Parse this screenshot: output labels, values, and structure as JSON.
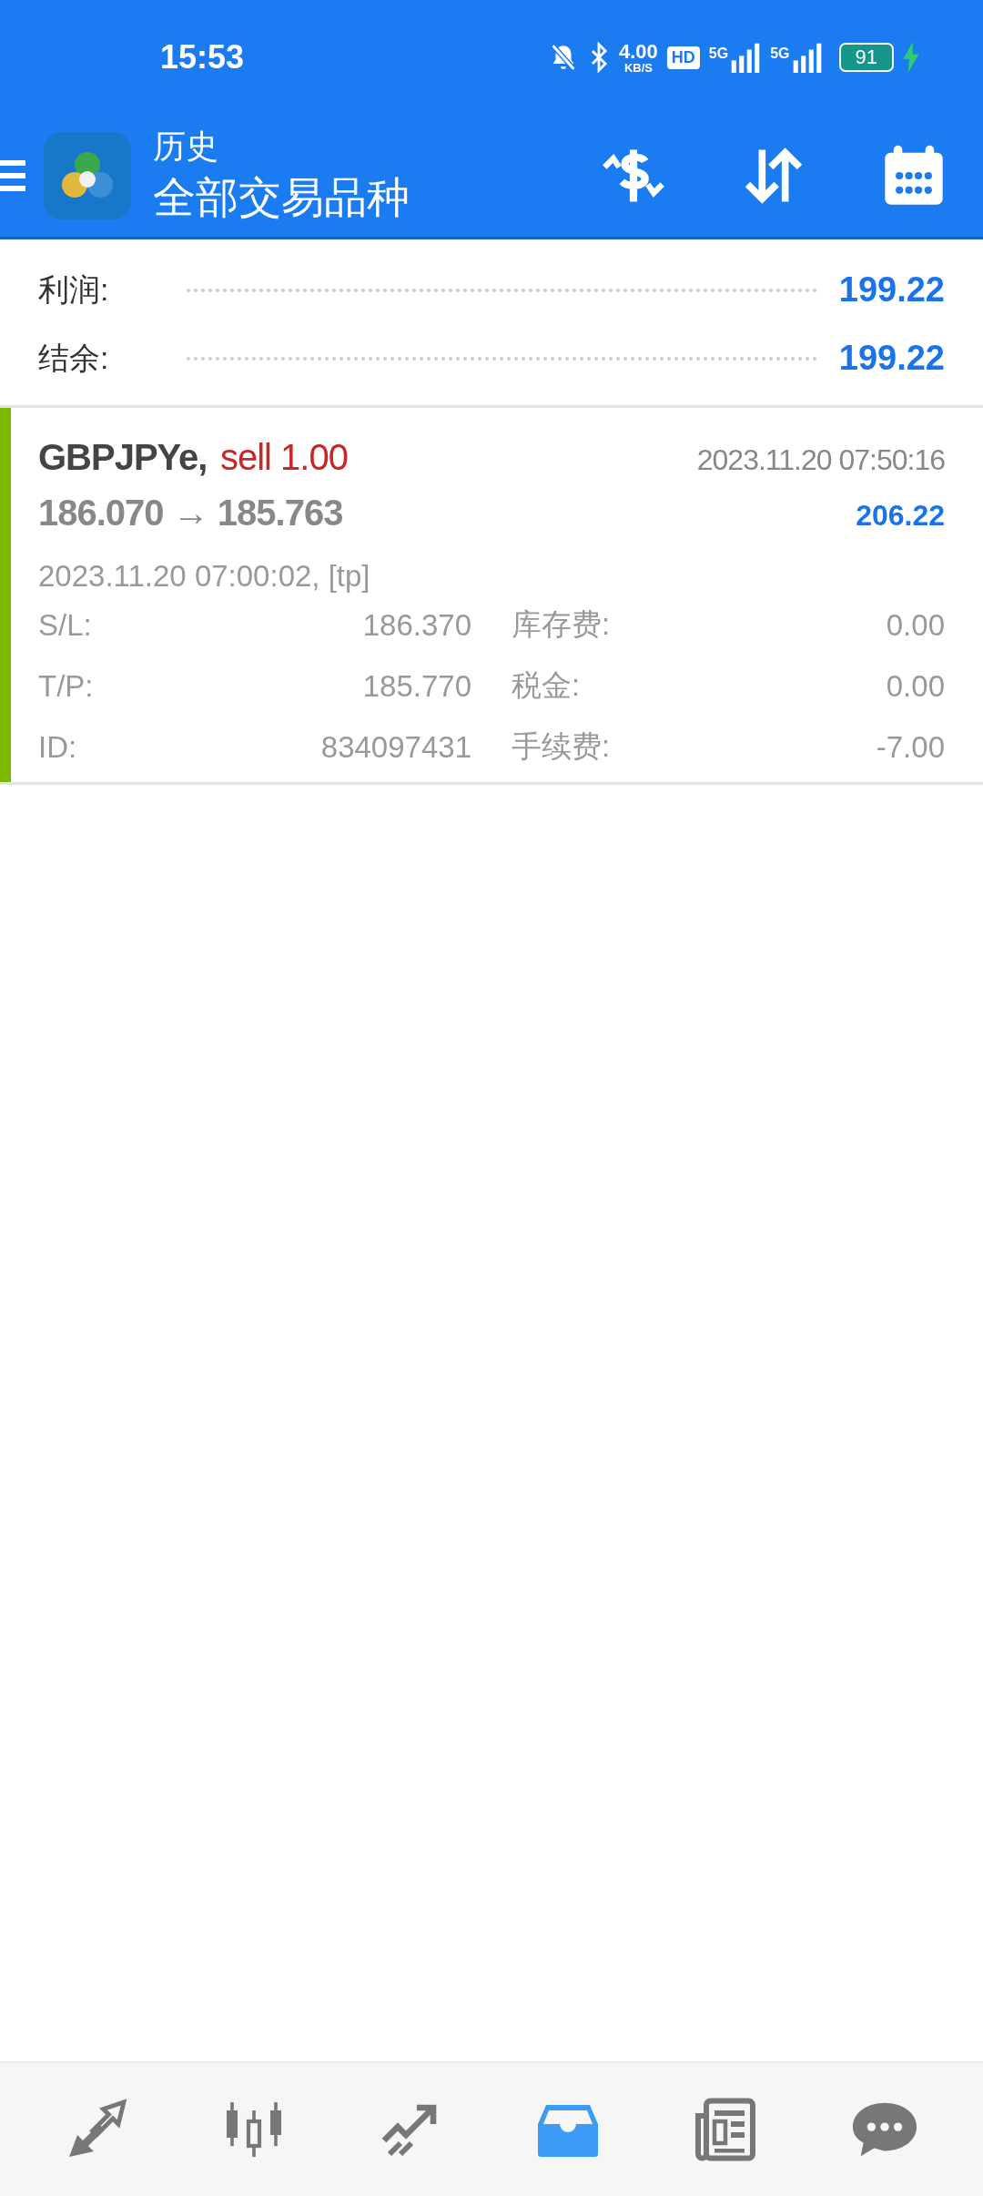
{
  "status_bar": {
    "time": "15:53",
    "speed": "4.00",
    "speed_unit": "KB/S",
    "hd": "HD",
    "networks": [
      "5G",
      "5G"
    ],
    "battery": "91",
    "charging": true
  },
  "header": {
    "subtitle": "历史",
    "title": "全部交易品种"
  },
  "summary": [
    {
      "label": "利润:",
      "value": "199.22"
    },
    {
      "label": "结余:",
      "value": "199.22"
    }
  ],
  "deals": [
    {
      "symbol": "GBPJPYe,",
      "side": "sell 1.00",
      "kind": "sell",
      "close_time": "2023.11.20 07:50:16",
      "prices": "186.070 → 185.763",
      "profit": "206.22",
      "open_info": "2023.11.20 07:00:02, [tp]",
      "fields": [
        {
          "label": "S/L:",
          "value": "186.370",
          "label2": "库存费:",
          "value2": "0.00"
        },
        {
          "label": "T/P:",
          "value": "185.770",
          "label2": "税金:",
          "value2": "0.00"
        },
        {
          "label": "ID:",
          "value": "834097431",
          "label2": "手续费:",
          "value2": "-7.00"
        }
      ]
    }
  ],
  "bottom_nav": [
    {
      "kind": "quotes",
      "selected": false
    },
    {
      "kind": "chart",
      "selected": false
    },
    {
      "kind": "trade",
      "selected": false
    },
    {
      "kind": "history",
      "selected": true
    },
    {
      "kind": "news",
      "selected": false
    },
    {
      "kind": "chat",
      "selected": false
    }
  ]
}
